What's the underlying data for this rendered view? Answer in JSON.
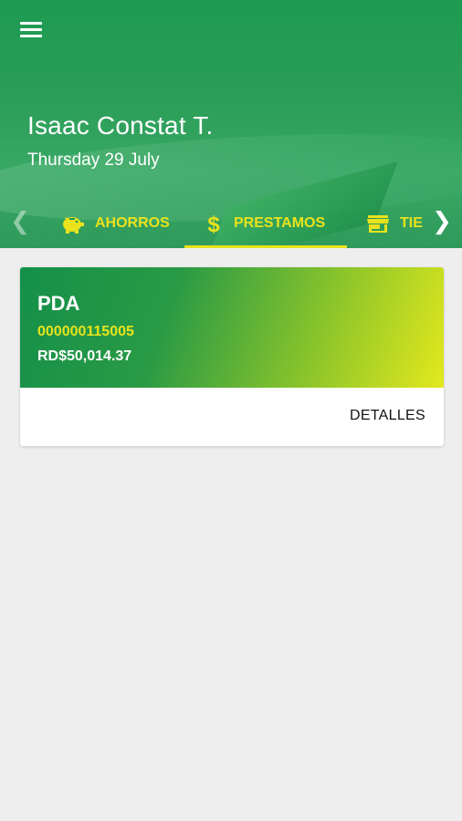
{
  "header": {
    "menu_icon": "hamburger-menu-icon",
    "user_name": "Isaac Constat T.",
    "date": "Thursday 29 July"
  },
  "tabs": [
    {
      "label": "AHORROS",
      "icon": "piggy-bank-icon",
      "active": false
    },
    {
      "label": "PRESTAMOS",
      "icon": "dollar-icon",
      "active": true
    },
    {
      "label": "TIE",
      "icon": "store-icon",
      "active": false
    }
  ],
  "colors": {
    "header_green": "#1e9a52",
    "accent_yellow": "#e9e21c",
    "background": "#eeeeee"
  },
  "loan_card": {
    "title": "PDA",
    "account_number": "000000115005",
    "amount": "RD$50,014.37",
    "details_label": "DETALLES"
  }
}
